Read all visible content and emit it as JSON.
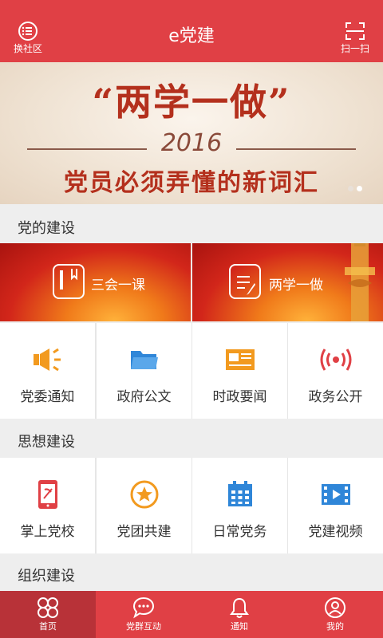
{
  "topbar": {
    "title": "e党建",
    "left_label": "换社区",
    "right_label": "扫一扫",
    "left_icon": "community-list-icon",
    "right_icon": "scan-icon",
    "color": "#e04045"
  },
  "banner": {
    "title": "“两学一做”",
    "year": "2016",
    "subtitle": "党员必须弄懂的新词汇",
    "slide_count": 2,
    "active_slide": 2
  },
  "sections": {
    "party_building": "党的建设",
    "ideology": "思想建设",
    "organization": "组织建设"
  },
  "cards": [
    {
      "label": "三会一课",
      "icon": "book-icon"
    },
    {
      "label": "两学一做",
      "icon": "document-edit-icon"
    }
  ],
  "party_grid": [
    {
      "label": "党委通知",
      "icon": "megaphone-icon",
      "color": "#f29a1f"
    },
    {
      "label": "政府公文",
      "icon": "folder-icon",
      "color": "#2f86d8"
    },
    {
      "label": "时政要闻",
      "icon": "newspaper-icon",
      "color": "#f29a1f"
    },
    {
      "label": "政务公开",
      "icon": "broadcast-icon",
      "color": "#e04045"
    }
  ],
  "ideology_grid": [
    {
      "label": "掌上党校",
      "icon": "mobile-party-icon",
      "color": "#e04045"
    },
    {
      "label": "党团共建",
      "icon": "star-badge-icon",
      "color": "#f29a1f"
    },
    {
      "label": "日常党务",
      "icon": "calendar-icon",
      "color": "#2f86d8"
    },
    {
      "label": "党建视频",
      "icon": "video-icon",
      "color": "#2f86d8"
    }
  ],
  "bottom_nav": [
    {
      "label": "首页",
      "icon": "home-grid-icon",
      "active": true
    },
    {
      "label": "党群互动",
      "icon": "chat-bubble-icon",
      "active": false
    },
    {
      "label": "通知",
      "icon": "bell-icon",
      "active": false
    },
    {
      "label": "我的",
      "icon": "user-icon",
      "active": false
    }
  ]
}
